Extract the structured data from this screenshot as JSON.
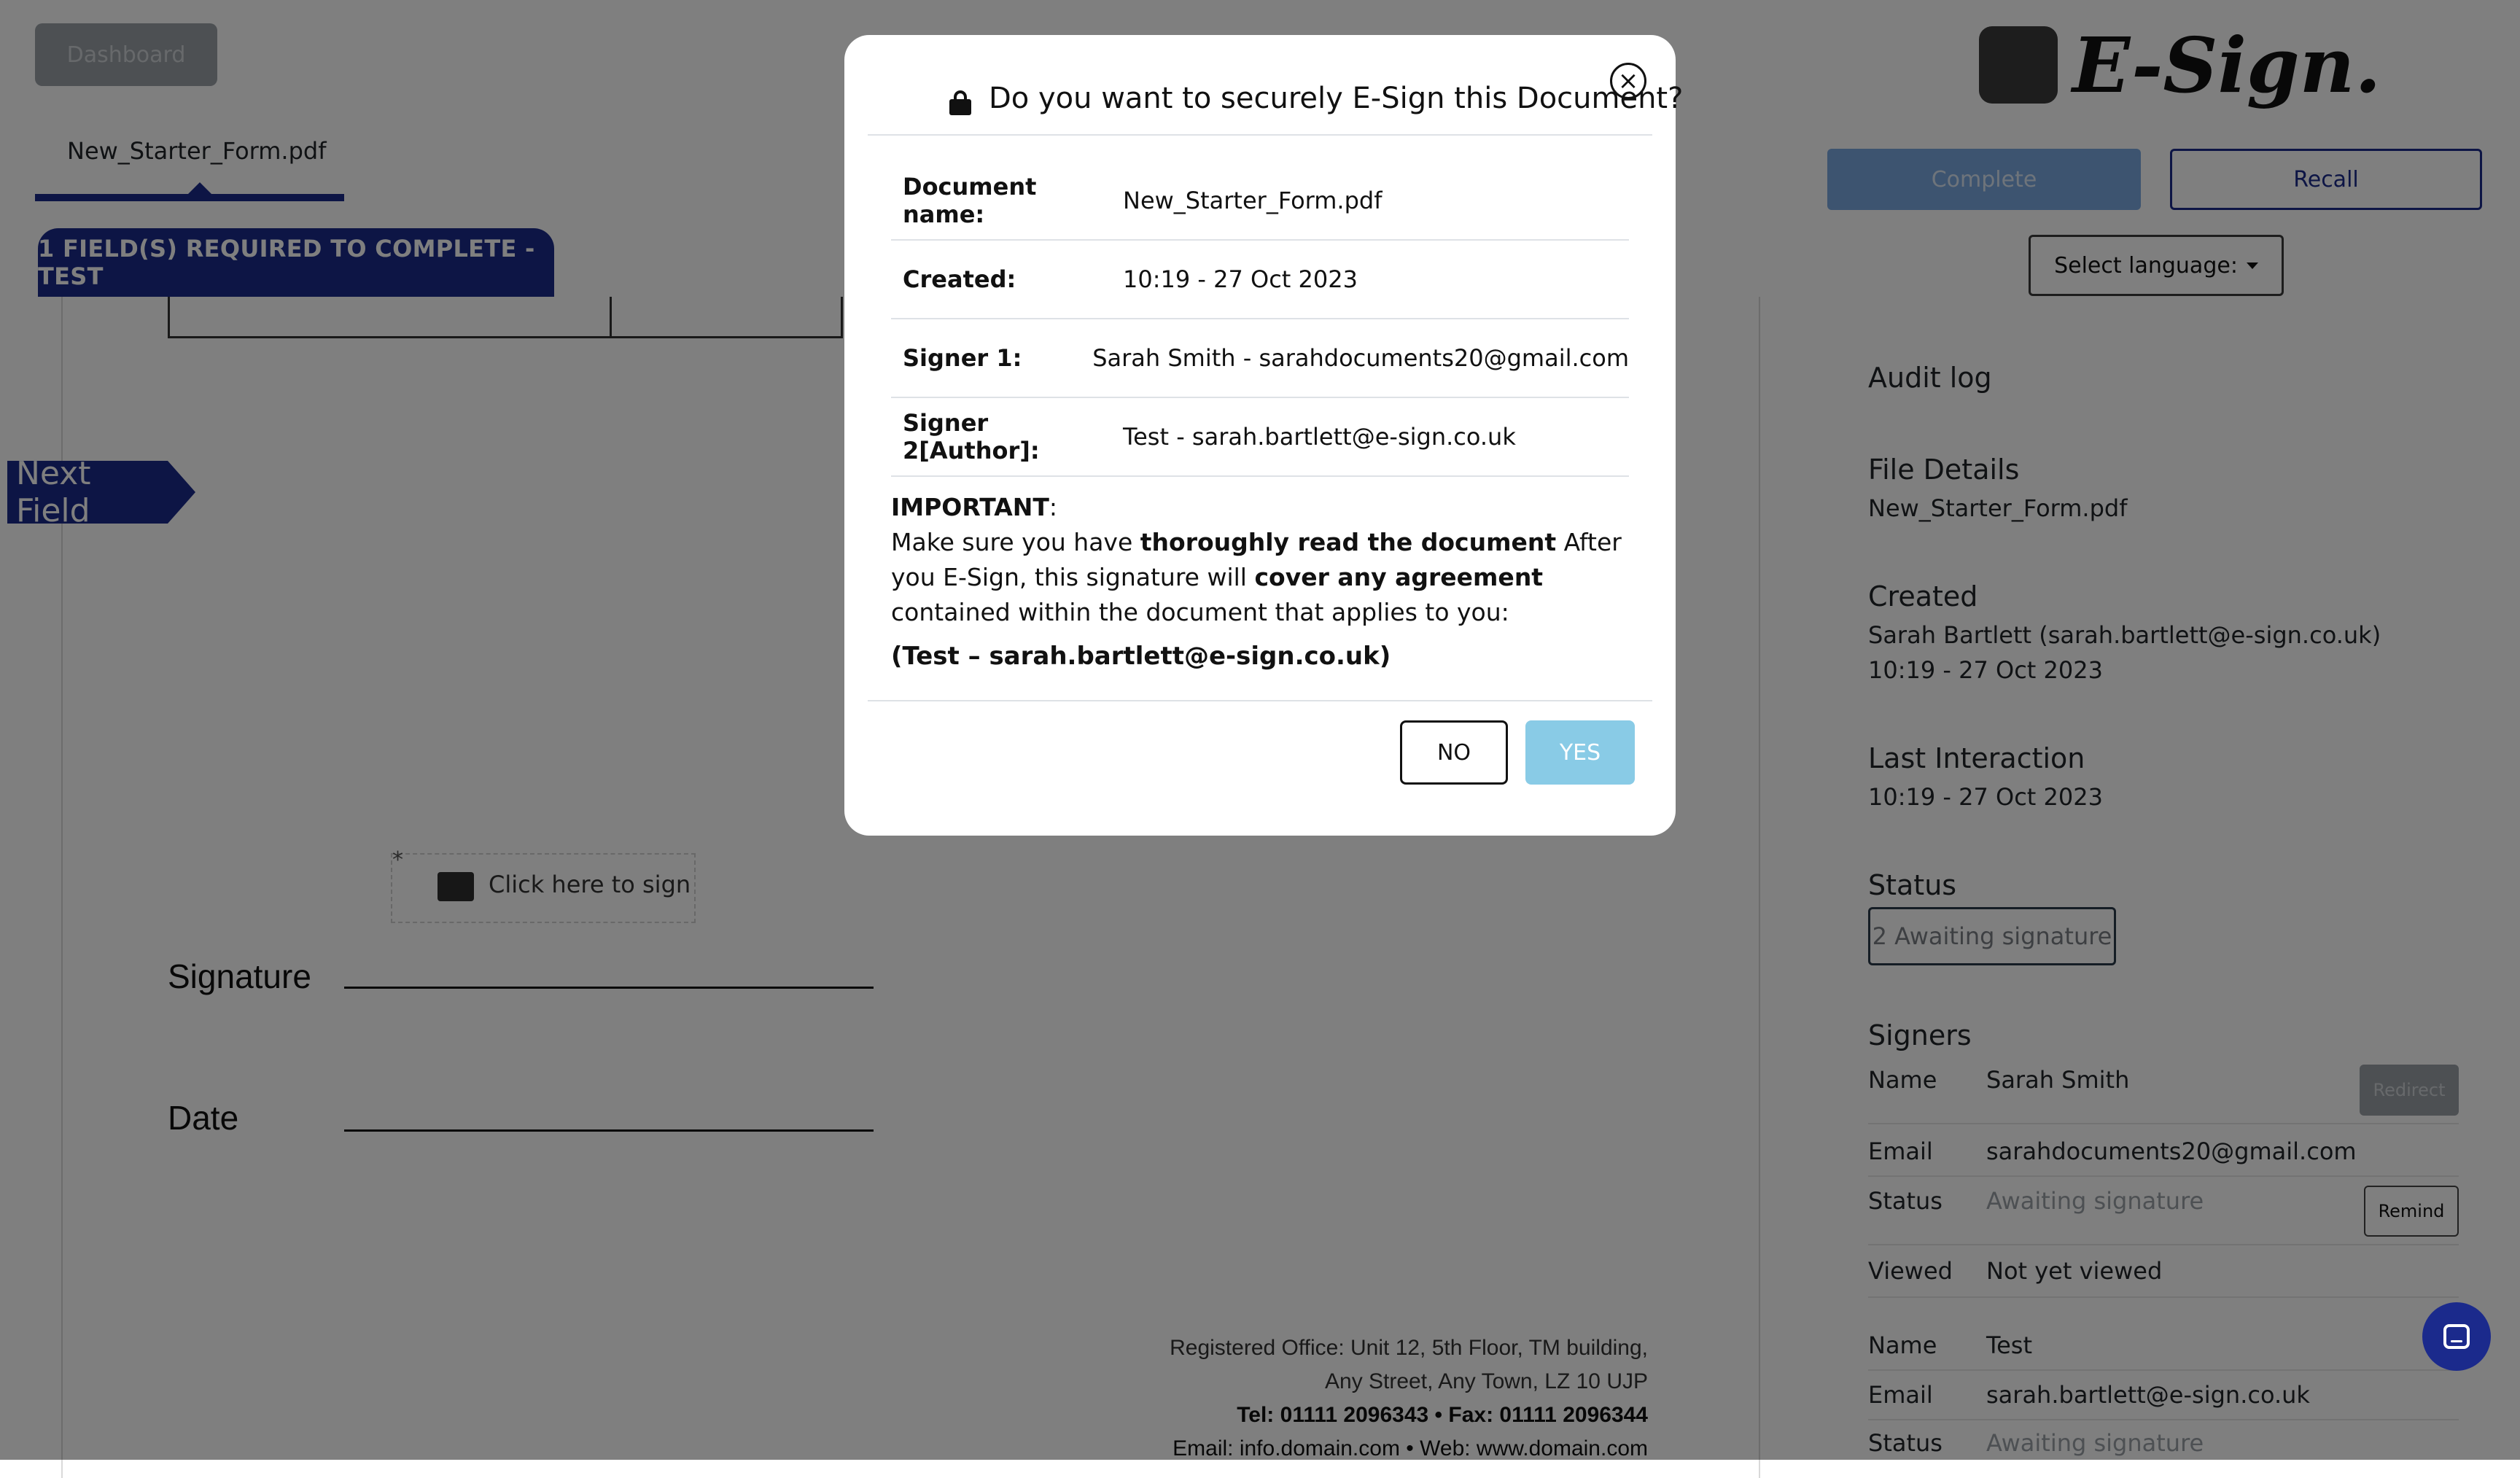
{
  "header": {
    "dashboard_label": "Dashboard",
    "document_tab": "New_Starter_Form.pdf",
    "required_banner": "1 FIELD(S) REQUIRED TO COMPLETE - TEST",
    "logo_text": "E-Sign."
  },
  "document": {
    "next_field_label": "Next Field",
    "sign_field_label": "Click here to sign",
    "signature_label": "Signature",
    "date_label": "Date",
    "footer": {
      "line1": "Registered Office: Unit 12, 5th Floor, TM building,",
      "line2": "Any Street, Any Town, LZ 10 UJP",
      "line3": "Tel: 01111 2096343  •  Fax:  01111 2096344",
      "line4": "Email: info.domain.com  •  Web: www.domain.com"
    }
  },
  "right_panel": {
    "complete_label": "Complete",
    "recall_label": "Recall",
    "language_label": "Select language:",
    "audit_log_title": "Audit log",
    "file_details_title": "File Details",
    "file_name": "New_Starter_Form.pdf",
    "created_title": "Created",
    "created_by": "Sarah Bartlett (sarah.bartlett@e-sign.co.uk)",
    "created_time": "10:19 - 27 Oct 2023",
    "last_interaction_title": "Last Interaction",
    "last_interaction_time": "10:19 - 27 Oct 2023",
    "status_title": "Status",
    "status_badge": "2 Awaiting signature",
    "signers_title": "Signers",
    "redirect_label": "Redirect",
    "remind_label": "Remind",
    "signers": [
      {
        "name_label": "Name",
        "name": "Sarah Smith",
        "email_label": "Email",
        "email": "sarahdocuments20@gmail.com",
        "status_label": "Status",
        "status": "Awaiting signature",
        "viewed_label": "Viewed",
        "viewed": "Not yet viewed"
      },
      {
        "name_label": "Name",
        "name": "Test",
        "email_label": "Email",
        "email": "sarah.bartlett@e-sign.co.uk",
        "status_label": "Status",
        "status": "Awaiting signature"
      }
    ]
  },
  "modal": {
    "title": "Do you want to securely E-Sign this Document?",
    "rows": [
      {
        "key": "Document name:",
        "value": "New_Starter_Form.pdf"
      },
      {
        "key": "Created:",
        "value": "10:19 - 27 Oct 2023"
      },
      {
        "key": "Signer 1:",
        "value": "Sarah Smith - sarahdocuments20@gmail.com"
      },
      {
        "key": "Signer 2[Author]:",
        "value": "Test - sarah.bartlett@e-sign.co.uk"
      }
    ],
    "important_label": "IMPORTANT",
    "important_colon": ":",
    "important_text_1": "Make sure you have ",
    "important_bold_1": "thoroughly read the document",
    "important_text_2": " After you E-Sign, this signature will ",
    "important_bold_2": "cover any agreement",
    "important_text_3": " contained within the document that applies to you:",
    "signer_identity": "(Test – sarah.bartlett@e-sign.co.uk)",
    "no_label": "NO",
    "yes_label": "YES"
  },
  "colors": {
    "brand_navy": "#1a2a8a",
    "yes_button": "#89cbe6",
    "overlay": "rgba(0,0,0,0.5)"
  },
  "icons": [
    "lock-icon",
    "close-icon",
    "signature-icon",
    "chat-icon",
    "caret-down-icon"
  ]
}
